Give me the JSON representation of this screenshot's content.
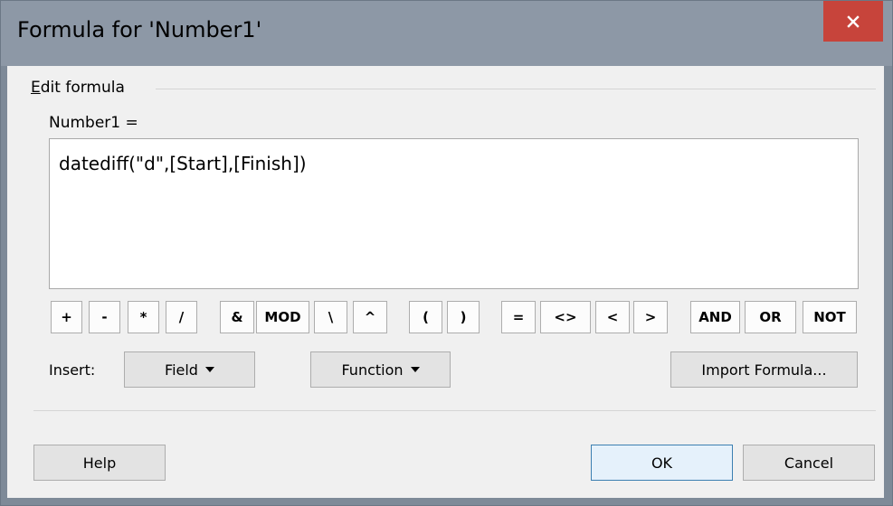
{
  "window": {
    "title": "Formula for 'Number1'",
    "close_icon": "close-icon",
    "close_color": "#c7443b"
  },
  "group": {
    "label_accel": "E",
    "label_rest": "dit formula"
  },
  "formula": {
    "label": "Number1 =",
    "value": "datediff(\"d\",[Start],[Finish])"
  },
  "operators": [
    "+",
    "-",
    "*",
    "/",
    "&",
    "MOD",
    "\\",
    "^",
    "(",
    ")",
    "=",
    "<>",
    "<",
    ">",
    "AND",
    "OR",
    "NOT"
  ],
  "insert": {
    "label": "Insert:",
    "field_label": "Field",
    "function_label": "Function",
    "import_label": "Import Formula..."
  },
  "footer": {
    "help_label": "Help",
    "ok_label": "OK",
    "cancel_label": "Cancel"
  }
}
